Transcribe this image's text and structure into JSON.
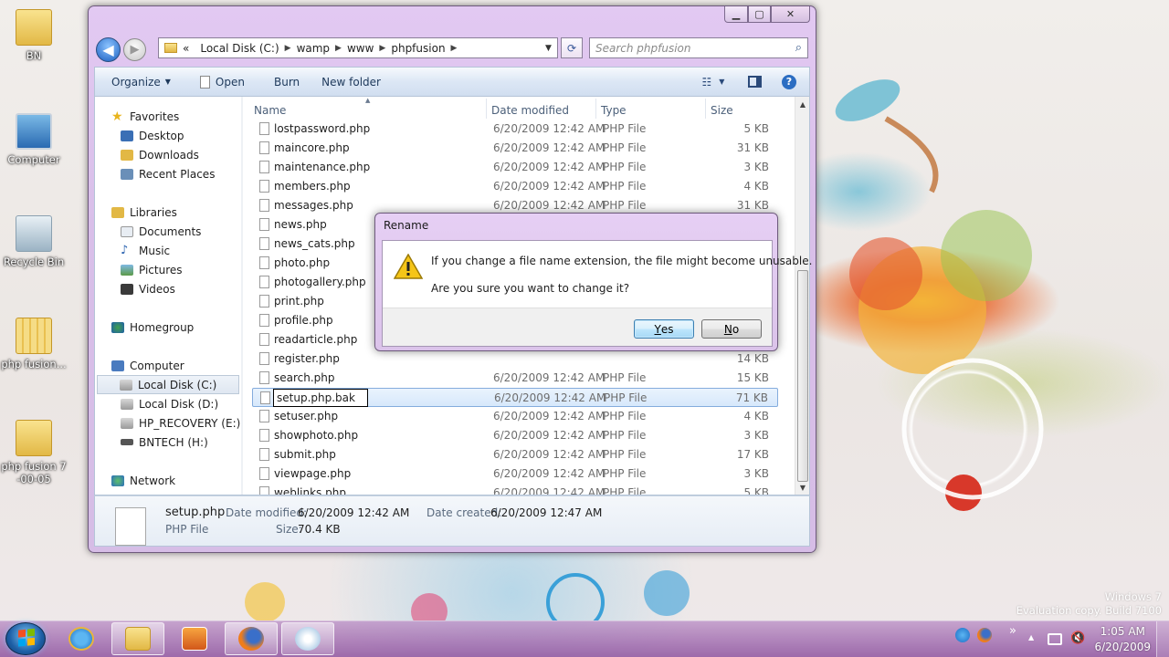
{
  "desktop": {
    "icons": [
      {
        "label": "BN"
      },
      {
        "label": "Computer"
      },
      {
        "label": "Recycle Bin"
      },
      {
        "label": "php fusion..."
      },
      {
        "label": "php fusion 7",
        "label2": "-00-05"
      }
    ],
    "watermark": {
      "line1": "Windows 7",
      "line2": "Evaluation copy. Build 7100"
    }
  },
  "explorer": {
    "caption": {
      "min": "▁",
      "max": "▢",
      "close": "✕"
    },
    "address": {
      "chevron": "«",
      "segments": [
        "Local Disk (C:)",
        "wamp",
        "www",
        "phpfusion"
      ]
    },
    "search_placeholder": "Search phpfusion",
    "toolbar": {
      "organize": "Organize",
      "open": "Open",
      "burn": "Burn",
      "new_folder": "New folder"
    },
    "nav": {
      "favorites": "Favorites",
      "desktop": "Desktop",
      "downloads": "Downloads",
      "recent": "Recent Places",
      "libraries": "Libraries",
      "documents": "Documents",
      "music": "Music",
      "pictures": "Pictures",
      "videos": "Videos",
      "homegroup": "Homegroup",
      "computer": "Computer",
      "c": "Local Disk (C:)",
      "d": "Local Disk (D:)",
      "e": "HP_RECOVERY (E:)",
      "h": "BNTECH (H:)",
      "network": "Network"
    },
    "columns": {
      "name": "Name",
      "date": "Date modified",
      "type": "Type",
      "size": "Size"
    },
    "files": [
      {
        "name": "lostpassword.php",
        "date": "6/20/2009 12:42 AM",
        "type": "PHP File",
        "size": "5 KB"
      },
      {
        "name": "maincore.php",
        "date": "6/20/2009 12:42 AM",
        "type": "PHP File",
        "size": "31 KB"
      },
      {
        "name": "maintenance.php",
        "date": "6/20/2009 12:42 AM",
        "type": "PHP File",
        "size": "3 KB"
      },
      {
        "name": "members.php",
        "date": "6/20/2009 12:42 AM",
        "type": "PHP File",
        "size": "4 KB"
      },
      {
        "name": "messages.php",
        "date": "6/20/2009 12:42 AM",
        "type": "PHP File",
        "size": "31 KB"
      },
      {
        "name": "news.php",
        "date": "",
        "type": "",
        "size": ""
      },
      {
        "name": "news_cats.php",
        "date": "",
        "type": "",
        "size": ""
      },
      {
        "name": "photo.php",
        "date": "",
        "type": "",
        "size": ""
      },
      {
        "name": "photogallery.php",
        "date": "",
        "type": "",
        "size": ""
      },
      {
        "name": "print.php",
        "date": "",
        "type": "",
        "size": ""
      },
      {
        "name": "profile.php",
        "date": "",
        "type": "",
        "size": ""
      },
      {
        "name": "readarticle.php",
        "date": "",
        "type": "",
        "size": ""
      },
      {
        "name": "register.php",
        "date": "",
        "type": "",
        "size": "14 KB"
      },
      {
        "name": "search.php",
        "date": "6/20/2009 12:42 AM",
        "type": "PHP File",
        "size": "15 KB"
      },
      {
        "name": "",
        "date": "6/20/2009 12:42 AM",
        "type": "PHP File",
        "size": "71 KB"
      },
      {
        "name": "setuser.php",
        "date": "6/20/2009 12:42 AM",
        "type": "PHP File",
        "size": "4 KB"
      },
      {
        "name": "showphoto.php",
        "date": "6/20/2009 12:42 AM",
        "type": "PHP File",
        "size": "3 KB"
      },
      {
        "name": "submit.php",
        "date": "6/20/2009 12:42 AM",
        "type": "PHP File",
        "size": "17 KB"
      },
      {
        "name": "viewpage.php",
        "date": "6/20/2009 12:42 AM",
        "type": "PHP File",
        "size": "3 KB"
      },
      {
        "name": "weblinks.php",
        "date": "6/20/2009 12:42 AM",
        "type": "PHP File",
        "size": "5 KB"
      }
    ],
    "rename_value": "setup.php.bak",
    "details": {
      "name": "setup.php",
      "type": "PHP File",
      "modified_label": "Date modified:",
      "modified": "6/20/2009 12:42 AM",
      "size_label": "Size:",
      "size": "70.4 KB",
      "created_label": "Date created:",
      "created": "6/20/2009 12:47 AM"
    }
  },
  "dialog": {
    "title": "Rename",
    "message": "If you change a file name extension, the file might become unusable.",
    "question": "Are you sure you want to change it?",
    "yes_u": "Y",
    "yes_rest": "es",
    "no_u": "N",
    "no_rest": "o"
  },
  "taskbar": {
    "clock_time": "1:05 AM",
    "clock_date": "6/20/2009",
    "tray_more": "»"
  }
}
